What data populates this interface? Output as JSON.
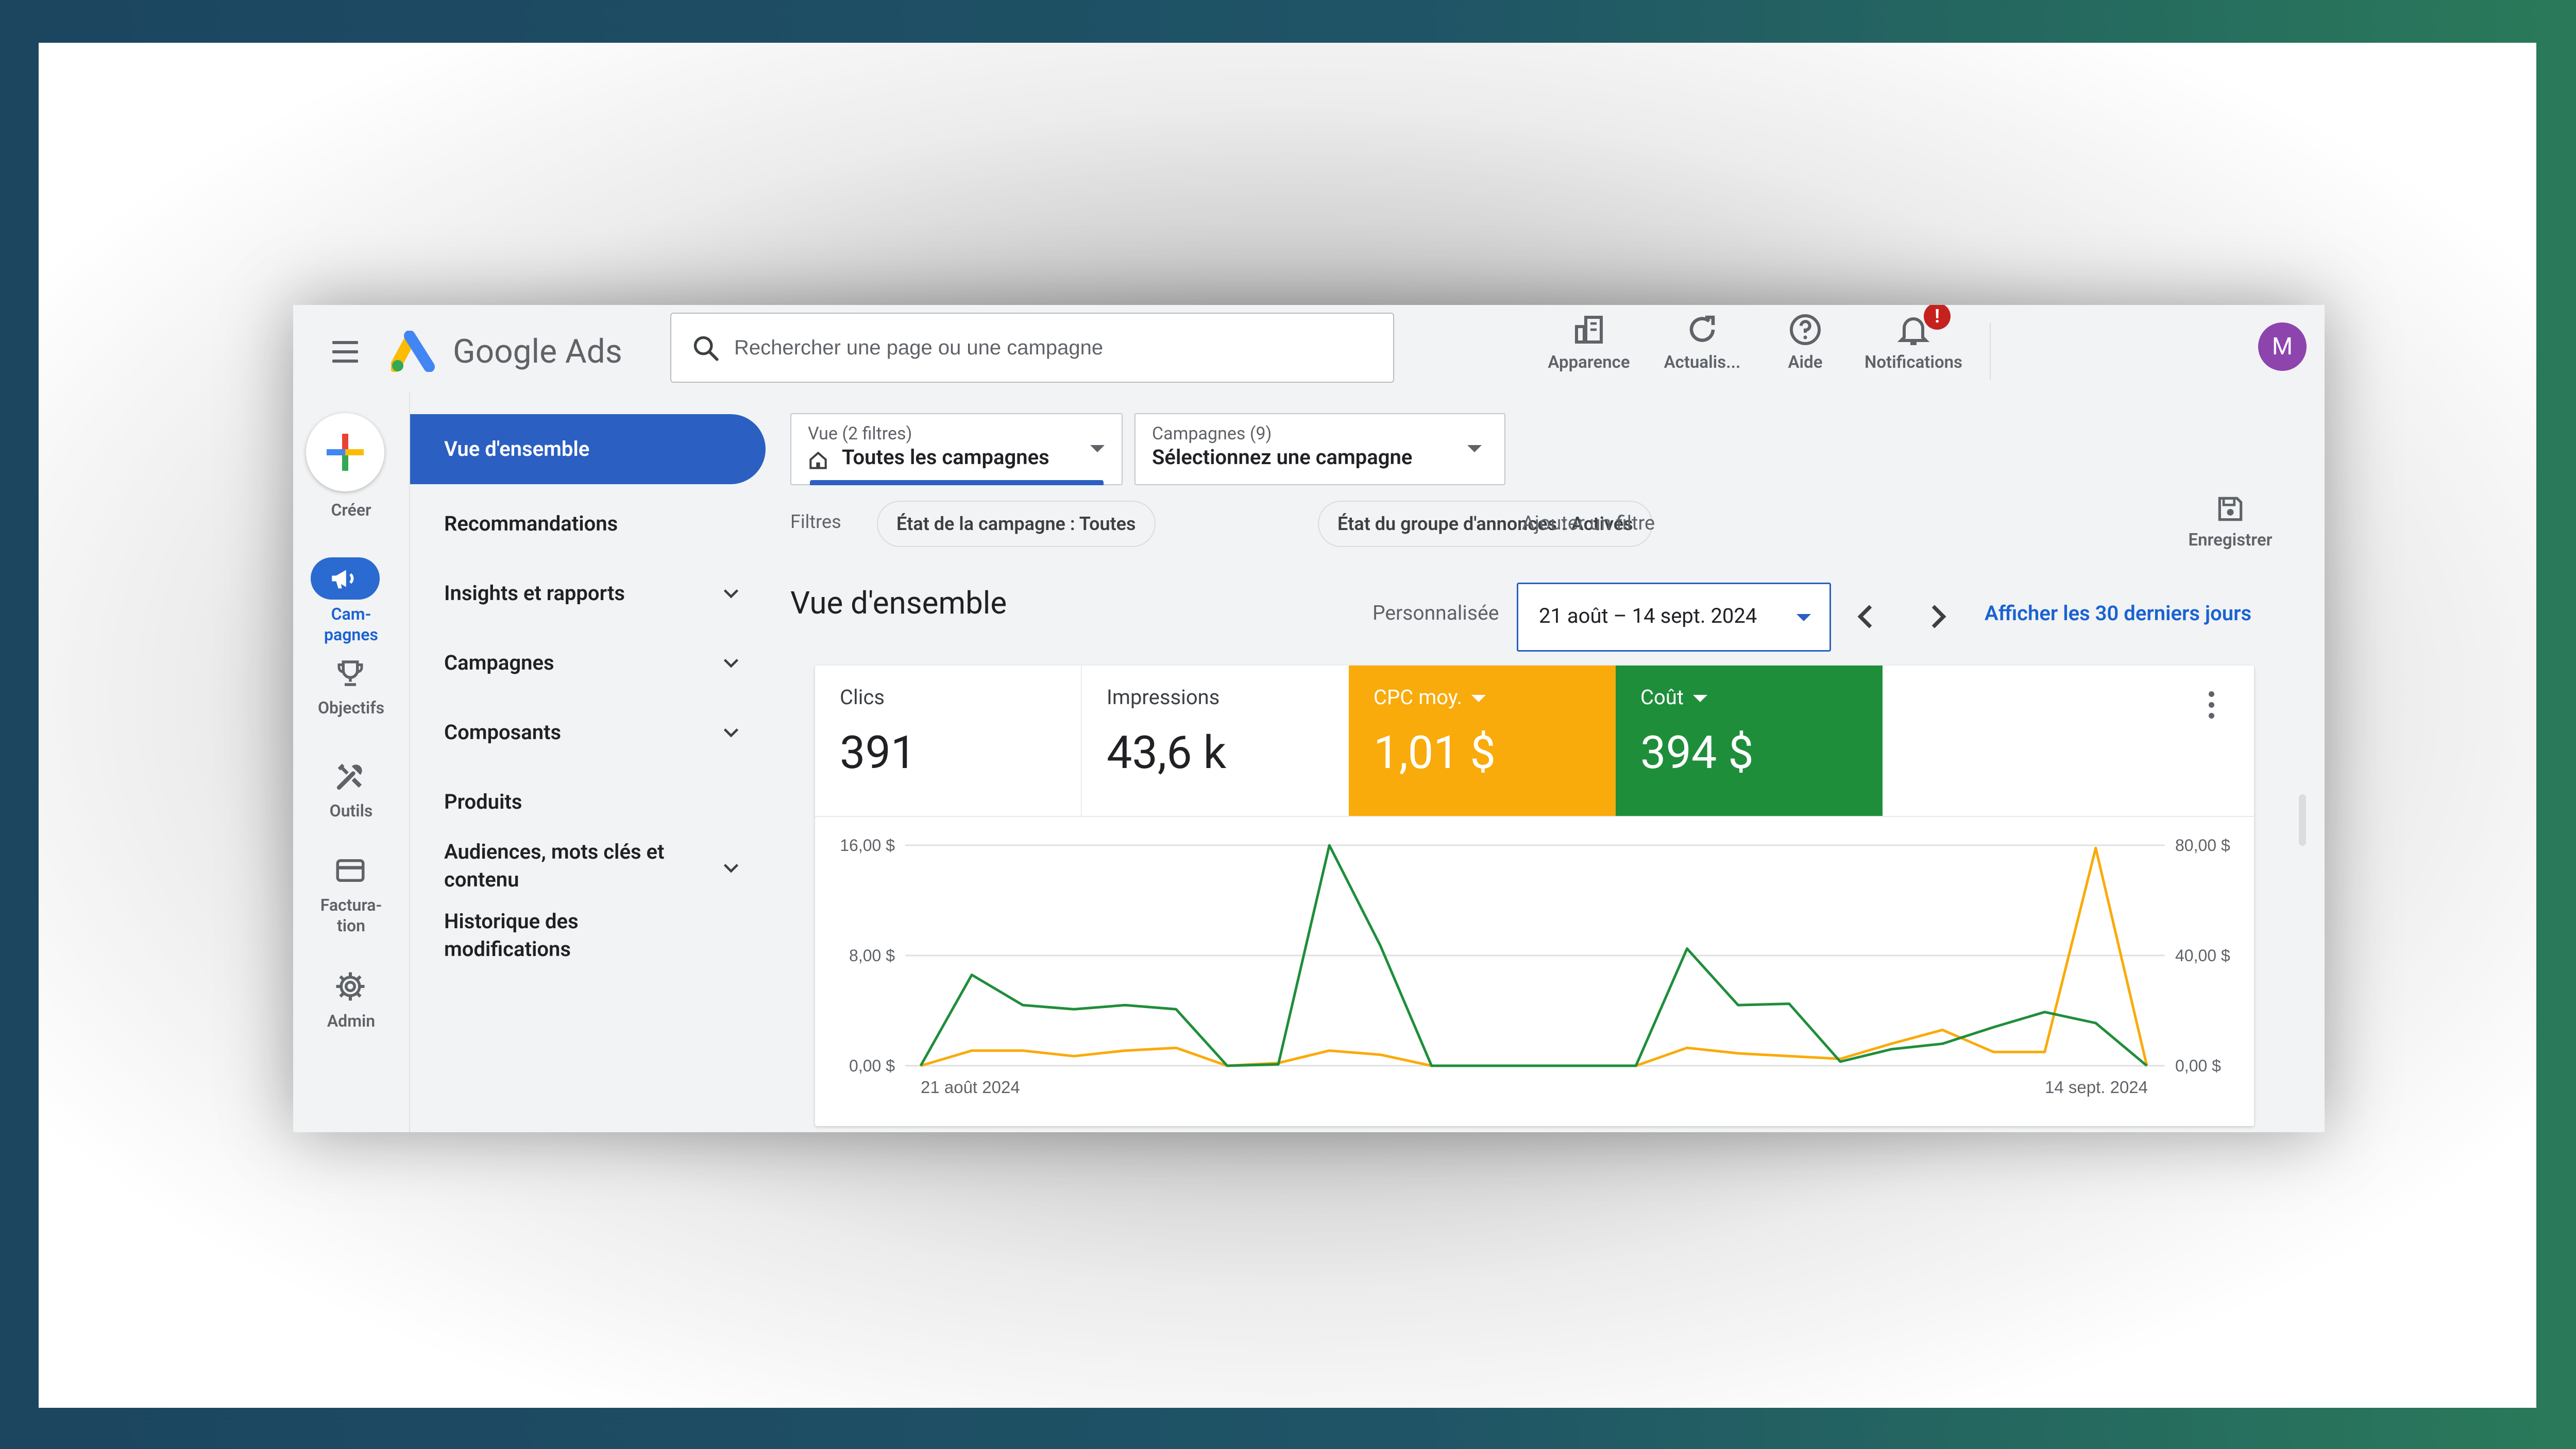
{
  "header": {
    "product_name": "Google Ads",
    "search_placeholder": "Rechercher une page ou une campagne",
    "buttons": {
      "appearance": "Apparence",
      "refresh": "Actualis...",
      "help": "Aide",
      "notifications": "Notifications"
    },
    "notification_badge": "!",
    "avatar_initial": "M"
  },
  "rail": {
    "create": "Créer",
    "campaigns": "Cam-\npagnes",
    "objectives": "Objectifs",
    "tools": "Outils",
    "billing": "Factura-\ntion",
    "admin": "Admin"
  },
  "sidenav": {
    "items": [
      {
        "label": "Vue d'ensemble",
        "active": true
      },
      {
        "label": "Recommandations"
      },
      {
        "label": "Insights et rapports",
        "expandable": true
      },
      {
        "label": "Campagnes",
        "expandable": true
      },
      {
        "label": "Composants",
        "expandable": true
      },
      {
        "label": "Produits"
      },
      {
        "label": "Audiences, mots clés et contenu",
        "expandable": true
      },
      {
        "label": "Historique des modifications"
      }
    ]
  },
  "main": {
    "view_drop": {
      "small": "Vue (2 filtres)",
      "value": "Toutes les campagnes"
    },
    "campaign_drop": {
      "small": "Campagnes (9)",
      "value": "Sélectionnez une campagne"
    },
    "filters_label": "Filtres",
    "filter_chips": [
      "État de la campagne : Toutes",
      "État du groupe d'annonces : Activés"
    ],
    "add_filter": "Ajouter un filtre",
    "save_label": "Enregistrer",
    "page_title": "Vue d'ensemble",
    "range_label": "Personnalisée",
    "date_range": "21 août – 14 sept. 2024",
    "last_30": "Afficher les 30 derniers jours",
    "metrics": [
      {
        "label": "Clics",
        "value": "391"
      },
      {
        "label": "Impressions",
        "value": "43,6 k"
      },
      {
        "label": "CPC moy.",
        "value": "1,01 $",
        "color": "#f9ab0b"
      },
      {
        "label": "Coût",
        "value": "394 $",
        "color": "#1f8e3b"
      }
    ]
  },
  "chart_data": {
    "type": "line",
    "x_start_label": "21 août 2024",
    "x_end_label": "14 sept. 2024",
    "y_left_ticks": [
      "0,00 $",
      "8,00 $",
      "16,00 $"
    ],
    "y_right_ticks": [
      "0,00 $",
      "40,00 $",
      "80,00 $"
    ],
    "y_left_range": [
      0,
      16
    ],
    "y_right_range": [
      0,
      80
    ],
    "grid": true,
    "series": [
      {
        "name": "CPC moy.",
        "axis": "left",
        "color": "#f9ab0b",
        "values": [
          0,
          1.1,
          1.1,
          0.7,
          1.1,
          1.3,
          0,
          0.2,
          1.1,
          0.8,
          0,
          0,
          0,
          0,
          0,
          1.3,
          0.9,
          0.7,
          0.5,
          1.6,
          2.6,
          1.0,
          1.0,
          15.8,
          0
        ]
      },
      {
        "name": "Coût",
        "axis": "right",
        "color": "#1f8e3b",
        "values": [
          0,
          33,
          22,
          20.5,
          22,
          20.5,
          0,
          0.5,
          80,
          43.5,
          0,
          0,
          0,
          0,
          0,
          42.5,
          22,
          22.5,
          1.5,
          6,
          8,
          14,
          19.5,
          15.5,
          0
        ]
      }
    ]
  }
}
